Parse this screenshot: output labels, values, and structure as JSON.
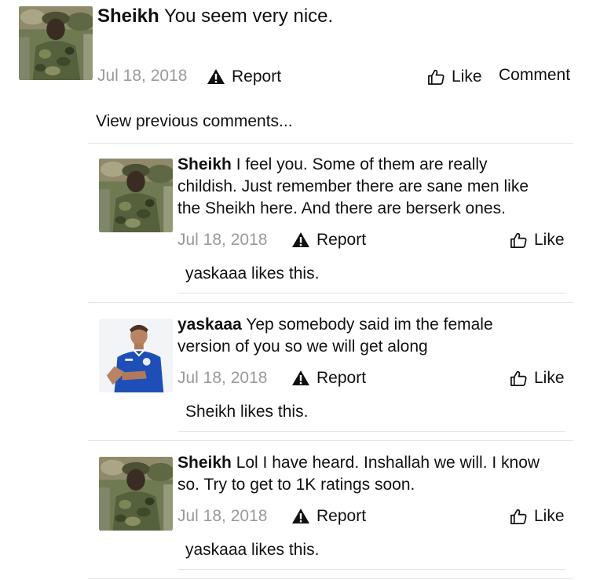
{
  "post": {
    "author": "Sheikh",
    "text": "You seem very nice.",
    "date": "Jul 18, 2018",
    "report_label": "Report",
    "like_label": "Like",
    "comment_label": "Comment"
  },
  "thread": {
    "view_previous_label": "View previous comments..."
  },
  "comments": [
    {
      "author": "Sheikh",
      "text_line1": "I feel you. Some of them are really",
      "text_line2": "childish. Just remember there are sane men like",
      "text_line3": "the Sheikh here. And there are berserk ones.",
      "date": "Jul 18, 2018",
      "report_label": "Report",
      "like_label": "Like",
      "likes_text": "yaskaaa likes this."
    },
    {
      "author": "yaskaaa",
      "text_line1": "Yep somebody said im the female",
      "text_line2": "version of you so we will get along",
      "date": "Jul 18, 2018",
      "report_label": "Report",
      "like_label": "Like",
      "likes_text": "Sheikh likes this."
    },
    {
      "author": "Sheikh",
      "text_line1": "Lol I have heard. Inshallah we will. I know",
      "text_line2": "so. Try to get to 1K ratings soon.",
      "date": "Jul 18, 2018",
      "report_label": "Report",
      "like_label": "Like",
      "likes_text": "yaskaaa likes this."
    }
  ]
}
